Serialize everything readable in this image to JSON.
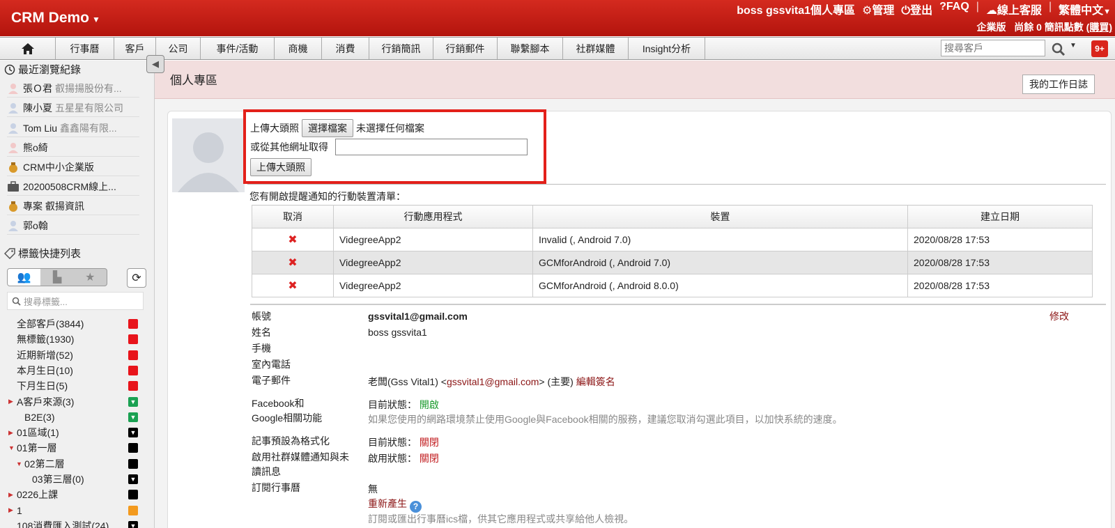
{
  "header": {
    "brand": "CRM Demo",
    "links": [
      "boss gssvita1個人專區",
      "管理",
      "登出",
      "FAQ",
      "線上客服",
      "繁體中文"
    ],
    "sub_edition": "企業版",
    "sub_balance": "尚餘 0 簡訊點數",
    "sub_buy": "(購買)"
  },
  "nav": {
    "tabs": [
      "行事曆",
      "客戶",
      "公司",
      "事件/活動",
      "商機",
      "消費",
      "行銷簡訊",
      "行銷郵件",
      "聯繫腳本",
      "社群媒體",
      "Insight分析"
    ],
    "search_placeholder": "搜尋客戶",
    "badge": "9+"
  },
  "sidebar": {
    "recent_title": "最近瀏覽紀錄",
    "recent": [
      {
        "name": "張Ｏ君",
        "company": "叡揚揚股份有..."
      },
      {
        "name": "陳小夏",
        "company": "五星星有限公司"
      },
      {
        "name": "Tom Liu",
        "company": "鑫鑫陽有限..."
      },
      {
        "name": "熊o綺",
        "company": ""
      },
      {
        "name": "CRM中小企業版",
        "company": ""
      },
      {
        "name": "20200508CRM線上...",
        "company": ""
      },
      {
        "name": "專案 叡揚資訊",
        "company": ""
      },
      {
        "name": "郭o翰",
        "company": ""
      }
    ],
    "tags_title": "標籤快捷列表",
    "tag_search_placeholder": "搜尋標籤...",
    "tags": [
      {
        "label": "全部客戶(3844)",
        "indent": 0,
        "arrow": "",
        "color": "#e8141b",
        "mark": ""
      },
      {
        "label": "無標籤(1930)",
        "indent": 0,
        "arrow": "",
        "color": "#e8141b",
        "mark": ""
      },
      {
        "label": "近期新增(52)",
        "indent": 0,
        "arrow": "",
        "color": "#e8141b",
        "mark": ""
      },
      {
        "label": "本月生日(10)",
        "indent": 0,
        "arrow": "",
        "color": "#e8141b",
        "mark": ""
      },
      {
        "label": "下月生日(5)",
        "indent": 0,
        "arrow": "",
        "color": "#e8141b",
        "mark": ""
      },
      {
        "label": "A客戶來源(3)",
        "indent": 0,
        "arrow": "▶",
        "color": "#1aa152",
        "mark": "▼"
      },
      {
        "label": "B2E(3)",
        "indent": 1,
        "arrow": "",
        "color": "#1aa152",
        "mark": "▼"
      },
      {
        "label": "01區域(1)",
        "indent": 0,
        "arrow": "▶",
        "color": "#000000",
        "mark": "▼"
      },
      {
        "label": "01第一層",
        "indent": 0,
        "arrow": "▼",
        "color": "#000000",
        "mark": ""
      },
      {
        "label": "02第二層",
        "indent": 1,
        "arrow": "▼",
        "color": "#000000",
        "mark": ""
      },
      {
        "label": "03第三層(0)",
        "indent": 2,
        "arrow": "",
        "color": "#000000",
        "mark": "▼"
      },
      {
        "label": "0226上課",
        "indent": 0,
        "arrow": "▶",
        "color": "#000000",
        "mark": ""
      },
      {
        "label": "1",
        "indent": 0,
        "arrow": "▶",
        "color": "#f39a1e",
        "mark": ""
      },
      {
        "label": "108消費匯入測試(24)",
        "indent": 0,
        "arrow": "",
        "color": "#000000",
        "mark": "▼"
      }
    ]
  },
  "main": {
    "page_title": "個人專區",
    "worklog_button": "我的工作日誌",
    "upload": {
      "label": "上傳大頭照",
      "choose_file": "選擇檔案",
      "no_file": "未選擇任何檔案",
      "url_label": "或從其他網址取得",
      "url_value": "",
      "submit": "上傳大頭照"
    },
    "devices_caption": "您有開啟提醒通知的行動裝置清單：",
    "devices_headers": [
      "取消",
      "行動應用程式",
      "裝置",
      "建立日期"
    ],
    "devices": [
      {
        "app": "VidegreeApp2",
        "device": "Invalid (, Android 7.0)",
        "date": "2020/08/28 17:53"
      },
      {
        "app": "VidegreeApp2",
        "device": "GCMforAndroid (, Android 7.0)",
        "date": "2020/08/28 17:53"
      },
      {
        "app": "VidegreeApp2",
        "device": "GCMforAndroid (, Android 8.0.0)",
        "date": "2020/08/28 17:53"
      }
    ],
    "info": {
      "account_label": "帳號",
      "account": "gssvital1@gmail.com",
      "edit": "修改",
      "name_label": "姓名",
      "name": "boss gssvita1",
      "mobile_label": "手機",
      "phone_label": "室內電話",
      "email_label": "電子郵件",
      "email_name": "老闆(Gss Vital1) <",
      "email_addr": "gssvital1@gmail.com",
      "email_suffix": "> (主要)",
      "edit_signature": "編輯簽名",
      "fb_label_1": "Facebook和",
      "fb_label_2": "Google相關功能",
      "fb_status_label": "目前狀態：",
      "fb_status": "開啟",
      "fb_note": "如果您使用的網路環境禁止使用Google與Facebook相關的服務，建議您取消勾選此項目，以加快系統的速度。",
      "note_label": "記事預設為格式化",
      "note_status_label": "目前狀態：",
      "note_status": "關閉",
      "social_label_1": "啟用社群媒體通知與未",
      "social_label_2": "讀訊息",
      "social_status_label": "啟用狀態：",
      "social_status": "關閉",
      "calendar_label": "訂閱行事曆",
      "calendar_value": "無",
      "regenerate": "重新產生",
      "calendar_note": "訂閱或匯出行事曆ics檔，供其它應用程式或共享給他人檢視。"
    }
  }
}
